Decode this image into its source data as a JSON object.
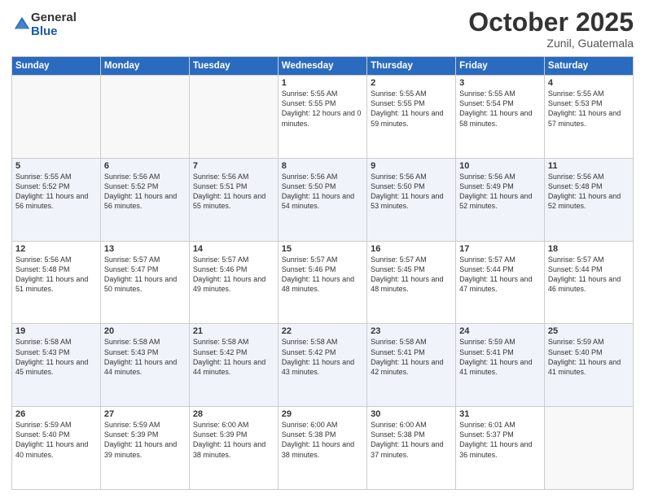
{
  "logo": {
    "general": "General",
    "blue": "Blue"
  },
  "header": {
    "month": "October 2025",
    "location": "Zunil, Guatemala"
  },
  "weekdays": [
    "Sunday",
    "Monday",
    "Tuesday",
    "Wednesday",
    "Thursday",
    "Friday",
    "Saturday"
  ],
  "weeks": [
    [
      {
        "day": "",
        "sunrise": "",
        "sunset": "",
        "daylight": ""
      },
      {
        "day": "",
        "sunrise": "",
        "sunset": "",
        "daylight": ""
      },
      {
        "day": "",
        "sunrise": "",
        "sunset": "",
        "daylight": ""
      },
      {
        "day": "1",
        "sunrise": "Sunrise: 5:55 AM",
        "sunset": "Sunset: 5:55 PM",
        "daylight": "Daylight: 12 hours and 0 minutes."
      },
      {
        "day": "2",
        "sunrise": "Sunrise: 5:55 AM",
        "sunset": "Sunset: 5:55 PM",
        "daylight": "Daylight: 11 hours and 59 minutes."
      },
      {
        "day": "3",
        "sunrise": "Sunrise: 5:55 AM",
        "sunset": "Sunset: 5:54 PM",
        "daylight": "Daylight: 11 hours and 58 minutes."
      },
      {
        "day": "4",
        "sunrise": "Sunrise: 5:55 AM",
        "sunset": "Sunset: 5:53 PM",
        "daylight": "Daylight: 11 hours and 57 minutes."
      }
    ],
    [
      {
        "day": "5",
        "sunrise": "Sunrise: 5:55 AM",
        "sunset": "Sunset: 5:52 PM",
        "daylight": "Daylight: 11 hours and 56 minutes."
      },
      {
        "day": "6",
        "sunrise": "Sunrise: 5:56 AM",
        "sunset": "Sunset: 5:52 PM",
        "daylight": "Daylight: 11 hours and 56 minutes."
      },
      {
        "day": "7",
        "sunrise": "Sunrise: 5:56 AM",
        "sunset": "Sunset: 5:51 PM",
        "daylight": "Daylight: 11 hours and 55 minutes."
      },
      {
        "day": "8",
        "sunrise": "Sunrise: 5:56 AM",
        "sunset": "Sunset: 5:50 PM",
        "daylight": "Daylight: 11 hours and 54 minutes."
      },
      {
        "day": "9",
        "sunrise": "Sunrise: 5:56 AM",
        "sunset": "Sunset: 5:50 PM",
        "daylight": "Daylight: 11 hours and 53 minutes."
      },
      {
        "day": "10",
        "sunrise": "Sunrise: 5:56 AM",
        "sunset": "Sunset: 5:49 PM",
        "daylight": "Daylight: 11 hours and 52 minutes."
      },
      {
        "day": "11",
        "sunrise": "Sunrise: 5:56 AM",
        "sunset": "Sunset: 5:48 PM",
        "daylight": "Daylight: 11 hours and 52 minutes."
      }
    ],
    [
      {
        "day": "12",
        "sunrise": "Sunrise: 5:56 AM",
        "sunset": "Sunset: 5:48 PM",
        "daylight": "Daylight: 11 hours and 51 minutes."
      },
      {
        "day": "13",
        "sunrise": "Sunrise: 5:57 AM",
        "sunset": "Sunset: 5:47 PM",
        "daylight": "Daylight: 11 hours and 50 minutes."
      },
      {
        "day": "14",
        "sunrise": "Sunrise: 5:57 AM",
        "sunset": "Sunset: 5:46 PM",
        "daylight": "Daylight: 11 hours and 49 minutes."
      },
      {
        "day": "15",
        "sunrise": "Sunrise: 5:57 AM",
        "sunset": "Sunset: 5:46 PM",
        "daylight": "Daylight: 11 hours and 48 minutes."
      },
      {
        "day": "16",
        "sunrise": "Sunrise: 5:57 AM",
        "sunset": "Sunset: 5:45 PM",
        "daylight": "Daylight: 11 hours and 48 minutes."
      },
      {
        "day": "17",
        "sunrise": "Sunrise: 5:57 AM",
        "sunset": "Sunset: 5:44 PM",
        "daylight": "Daylight: 11 hours and 47 minutes."
      },
      {
        "day": "18",
        "sunrise": "Sunrise: 5:57 AM",
        "sunset": "Sunset: 5:44 PM",
        "daylight": "Daylight: 11 hours and 46 minutes."
      }
    ],
    [
      {
        "day": "19",
        "sunrise": "Sunrise: 5:58 AM",
        "sunset": "Sunset: 5:43 PM",
        "daylight": "Daylight: 11 hours and 45 minutes."
      },
      {
        "day": "20",
        "sunrise": "Sunrise: 5:58 AM",
        "sunset": "Sunset: 5:43 PM",
        "daylight": "Daylight: 11 hours and 44 minutes."
      },
      {
        "day": "21",
        "sunrise": "Sunrise: 5:58 AM",
        "sunset": "Sunset: 5:42 PM",
        "daylight": "Daylight: 11 hours and 44 minutes."
      },
      {
        "day": "22",
        "sunrise": "Sunrise: 5:58 AM",
        "sunset": "Sunset: 5:42 PM",
        "daylight": "Daylight: 11 hours and 43 minutes."
      },
      {
        "day": "23",
        "sunrise": "Sunrise: 5:58 AM",
        "sunset": "Sunset: 5:41 PM",
        "daylight": "Daylight: 11 hours and 42 minutes."
      },
      {
        "day": "24",
        "sunrise": "Sunrise: 5:59 AM",
        "sunset": "Sunset: 5:41 PM",
        "daylight": "Daylight: 11 hours and 41 minutes."
      },
      {
        "day": "25",
        "sunrise": "Sunrise: 5:59 AM",
        "sunset": "Sunset: 5:40 PM",
        "daylight": "Daylight: 11 hours and 41 minutes."
      }
    ],
    [
      {
        "day": "26",
        "sunrise": "Sunrise: 5:59 AM",
        "sunset": "Sunset: 5:40 PM",
        "daylight": "Daylight: 11 hours and 40 minutes."
      },
      {
        "day": "27",
        "sunrise": "Sunrise: 5:59 AM",
        "sunset": "Sunset: 5:39 PM",
        "daylight": "Daylight: 11 hours and 39 minutes."
      },
      {
        "day": "28",
        "sunrise": "Sunrise: 6:00 AM",
        "sunset": "Sunset: 5:39 PM",
        "daylight": "Daylight: 11 hours and 38 minutes."
      },
      {
        "day": "29",
        "sunrise": "Sunrise: 6:00 AM",
        "sunset": "Sunset: 5:38 PM",
        "daylight": "Daylight: 11 hours and 38 minutes."
      },
      {
        "day": "30",
        "sunrise": "Sunrise: 6:00 AM",
        "sunset": "Sunset: 5:38 PM",
        "daylight": "Daylight: 11 hours and 37 minutes."
      },
      {
        "day": "31",
        "sunrise": "Sunrise: 6:01 AM",
        "sunset": "Sunset: 5:37 PM",
        "daylight": "Daylight: 11 hours and 36 minutes."
      },
      {
        "day": "",
        "sunrise": "",
        "sunset": "",
        "daylight": ""
      }
    ]
  ]
}
